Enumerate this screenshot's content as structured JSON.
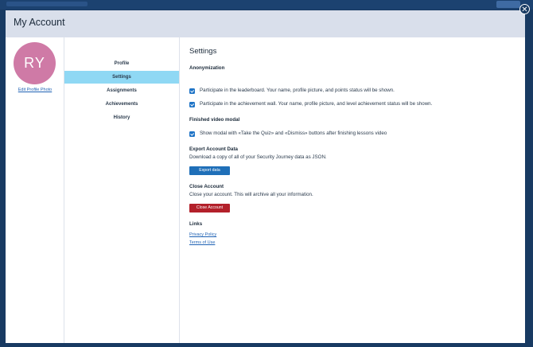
{
  "modal": {
    "title": "My Account",
    "close_icon": "close-icon"
  },
  "profile": {
    "initials": "RY",
    "avatar_color": "#cf7aa6",
    "edit_photo_label": "Edit Profile Photo"
  },
  "nav": {
    "items": [
      {
        "label": "Profile",
        "active": false
      },
      {
        "label": "Settings",
        "active": true
      },
      {
        "label": "Assignments",
        "active": false
      },
      {
        "label": "Achievements",
        "active": false
      },
      {
        "label": "History",
        "active": false
      }
    ]
  },
  "settings": {
    "title": "Settings",
    "anonymization": {
      "heading": "Anonymization",
      "options": [
        {
          "label": "Participate in the leaderboard. Your name, profile picture, and points status will be shown.",
          "checked": true
        },
        {
          "label": "Participate in the achievement wall. Your name, profile picture, and level achievement status will be shown.",
          "checked": true
        }
      ]
    },
    "finished_video": {
      "heading": "Finished video modal",
      "option": {
        "label": "Show modal with «Take the Quiz» and «Dismiss» buttons after finishing lessons video",
        "checked": true
      }
    },
    "export": {
      "heading": "Export Account Data",
      "description": "Download a copy of all of your Security Journey data as JSON.",
      "button_label": "Export data"
    },
    "close_account": {
      "heading": "Close Account",
      "description": "Close your account. This will archive all your information.",
      "button_label": "Close Account"
    },
    "links": {
      "heading": "Links",
      "privacy_policy": "Privacy Policy",
      "terms_of_use": "Terms of Use"
    }
  },
  "colors": {
    "backdrop": "#183a62",
    "header": "#d9dfeb",
    "nav_active": "#8fd8f4",
    "primary_button": "#1f6fb8",
    "danger_button": "#b3202a",
    "checkbox": "#1f74c6"
  }
}
